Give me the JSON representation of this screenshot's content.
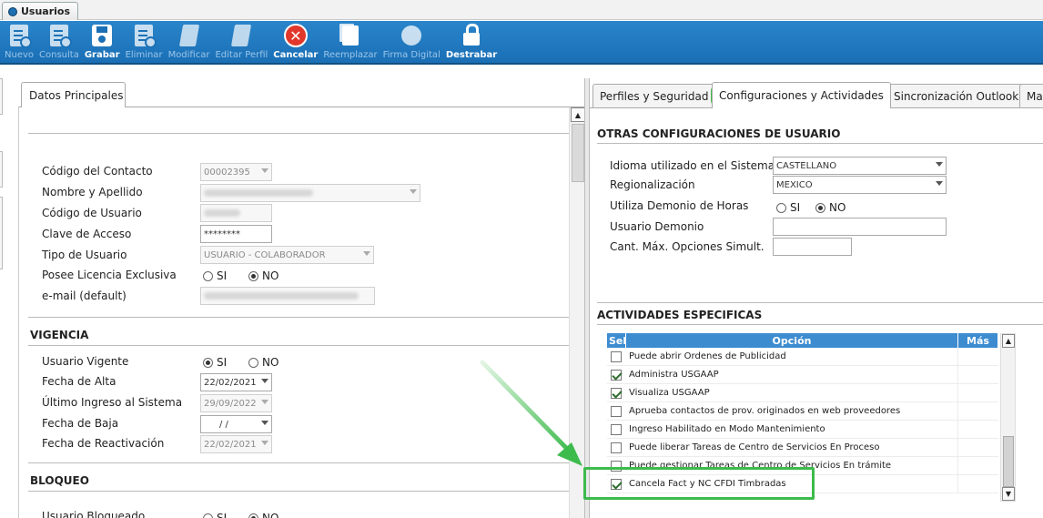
{
  "window_tab": {
    "title": "Usuarios"
  },
  "toolbar": {
    "buttons": [
      {
        "label": "Nuevo",
        "icon": "new-doc-icon"
      },
      {
        "label": "Consulta",
        "icon": "query-doc-icon"
      },
      {
        "label": "Grabar",
        "icon": "save-disk-icon"
      },
      {
        "label": "Eliminar",
        "icon": "delete-doc-icon"
      },
      {
        "label": "Modificar",
        "icon": "edit-icon"
      },
      {
        "label": "Editar Perfil",
        "icon": "edit-profile-icon"
      },
      {
        "label": "Cancelar",
        "icon": "cancel-icon"
      },
      {
        "label": "Reemplazar",
        "icon": "replace-icon"
      },
      {
        "label": "Firma Digital",
        "icon": "digital-signature-icon"
      },
      {
        "label": "Destrabar",
        "icon": "unlock-icon"
      }
    ]
  },
  "left": {
    "tab": "Datos Principales",
    "contact_code_label": "Código del Contacto",
    "contact_code_value": "00002395",
    "name_label": "Nombre y Apellido",
    "user_code_label": "Código de Usuario",
    "password_label": "Clave de Acceso",
    "password_value": "********",
    "user_type_label": "Tipo de Usuario",
    "user_type_value": "USUARIO - COLABORADOR",
    "license_label": "Posee Licencia Exclusiva",
    "email_label": "e-mail (default)",
    "si": "SI",
    "no": "NO",
    "vigencia_title": "VIGENCIA",
    "active_user_label": "Usuario Vigente",
    "start_date_label": "Fecha de Alta",
    "start_date_value": "22/02/2021",
    "last_login_label": "Último Ingreso al Sistema",
    "last_login_value": "29/09/2022",
    "end_date_label": "Fecha de Baja",
    "end_date_value": " /  /",
    "reactivation_label": "Fecha de Reactivación",
    "reactivation_value": "22/02/2021",
    "bloqueo_title": "BLOQUEO",
    "blocked_label": "Usuario Bloqueado"
  },
  "right": {
    "tabs": [
      "Perfiles y Seguridad",
      "Configuraciones y Actividades",
      "Sincronización Outlook",
      "Ma"
    ],
    "other_title": "OTRAS CONFIGURACIONES DE USUARIO",
    "language_label": "Idioma utilizado en el Sistema",
    "language_value": "CASTELLANO",
    "region_label": "Regionalización",
    "region_value": "MEXICO",
    "daemon_hours_label": "Utiliza Demonio de Horas",
    "daemon_user_label": "Usuario Demonio",
    "max_options_label": "Cant. Máx. Opciones Simult.",
    "si": "SI",
    "no": "NO",
    "activities_title": "ACTIVIDADES ESPECIFICAS",
    "grid_headers": {
      "sel": "Sel",
      "option": "Opción",
      "more": "Más"
    },
    "rows": [
      {
        "checked": false,
        "label": "Puede abrir Ordenes de Publicidad"
      },
      {
        "checked": true,
        "label": "Administra USGAAP"
      },
      {
        "checked": true,
        "label": "Visualiza USGAAP"
      },
      {
        "checked": false,
        "label": "Aprueba contactos de prov. originados en web proveedores"
      },
      {
        "checked": false,
        "label": "Ingreso Habilitado en Modo Mantenimiento"
      },
      {
        "checked": false,
        "label": "Puede liberar Tareas de Centro de Servicios En Proceso"
      },
      {
        "checked": false,
        "label": "Puede gestionar Tareas de Centro de Servicios En trámite"
      },
      {
        "checked": true,
        "label": "Cancela Fact y NC CFDI Timbradas"
      }
    ]
  },
  "colors": {
    "toolbar": "#1a6fb5",
    "grid_header": "#3d8cd0",
    "highlight": "#3dbb4c",
    "cancel": "#e2372b"
  }
}
